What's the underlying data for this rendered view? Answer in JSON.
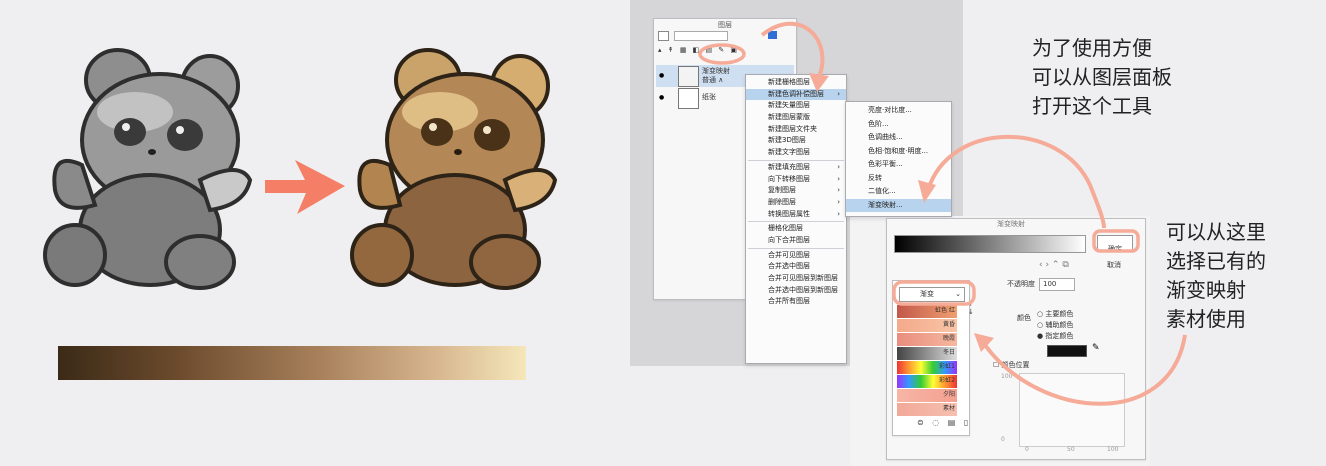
{
  "left_illustration": {
    "gray_bear_alt": "",
    "brown_bear_alt": "",
    "gradient_colors": [
      "#3b2a17",
      "#6b4a2c",
      "#a67f5a",
      "#d6b48d",
      "#f5e7ba"
    ]
  },
  "layer_panel": {
    "title": "图层",
    "layer1_name": "渐变映射",
    "layer1_sub": "普通 ∧",
    "layer2_name": "纸张"
  },
  "context_menu": {
    "items": [
      {
        "label": "新建栅格图层",
        "arrow": false
      },
      {
        "label": "新建色调补偿图层",
        "arrow": true,
        "selected": true
      },
      {
        "label": "新建矢量图层",
        "arrow": false
      },
      {
        "label": "新建图层蒙版",
        "arrow": false
      },
      {
        "label": "新建图层文件夹",
        "arrow": false
      },
      {
        "label": "新建3D图层",
        "arrow": false
      },
      {
        "label": "新建文字图层",
        "arrow": false
      },
      {
        "label": "sep"
      },
      {
        "label": "新建填充图层",
        "arrow": true
      },
      {
        "label": "向下转移图层",
        "arrow": true
      },
      {
        "label": "复制图层",
        "arrow": true
      },
      {
        "label": "删除图层",
        "arrow": true
      },
      {
        "label": "转换图层属性",
        "arrow": true
      },
      {
        "label": "sep"
      },
      {
        "label": "栅格化图层",
        "arrow": false
      },
      {
        "label": "向下合并图层",
        "arrow": false
      },
      {
        "label": "sep"
      },
      {
        "label": "合并可见图层",
        "arrow": false
      },
      {
        "label": "合并选中图层",
        "arrow": false
      },
      {
        "label": "合并可见图层到新图层",
        "arrow": false
      },
      {
        "label": "合并选中图层到新图层",
        "arrow": false
      },
      {
        "label": "合并所有图层",
        "arrow": false
      }
    ]
  },
  "submenu": {
    "items": [
      {
        "label": "亮度·对比度...",
        "selected": false
      },
      {
        "label": "色阶...",
        "selected": false
      },
      {
        "label": "色调曲线...",
        "selected": false
      },
      {
        "label": "色相·饱和度·明度...",
        "selected": false
      },
      {
        "label": "色彩平衡...",
        "selected": false
      },
      {
        "label": "反转",
        "selected": false
      },
      {
        "label": "二值化...",
        "selected": false
      },
      {
        "label": "渐变映射...",
        "selected": true
      }
    ]
  },
  "gradient_dialog": {
    "title": "渐变映射",
    "ok_button": "确定",
    "cancel_button": "取消",
    "set_dropdown": "渐变",
    "opacity_label": "不透明度",
    "opacity_value": "100",
    "color_label": "颜色",
    "radio_main": "主要颜色",
    "radio_sub": "辅助颜色",
    "radio_spec": "指定颜色",
    "checkbox_label": "颜色位置",
    "curve_axis_top": "100",
    "curve_axis_bottom": "0",
    "curve_x_left": "0",
    "curve_x_mid": "50",
    "curve_x_right": "100",
    "material_items": [
      "虹色 红",
      "黄昏",
      "晚霞",
      "冬日",
      "彩虹1",
      "彩虹2",
      "夕阳",
      "素材"
    ]
  },
  "annotations": {
    "note1_lines": [
      "为了使用方便",
      "可以从图层面板",
      "打开这个工具"
    ],
    "note2_lines": [
      "可以从这里",
      "选择已有的",
      "渐变映射",
      "素材使用"
    ]
  },
  "colors": {
    "arrow": "#f57f66",
    "highlight": "#f5ab97",
    "menu_selected": "#b8d3ee"
  }
}
